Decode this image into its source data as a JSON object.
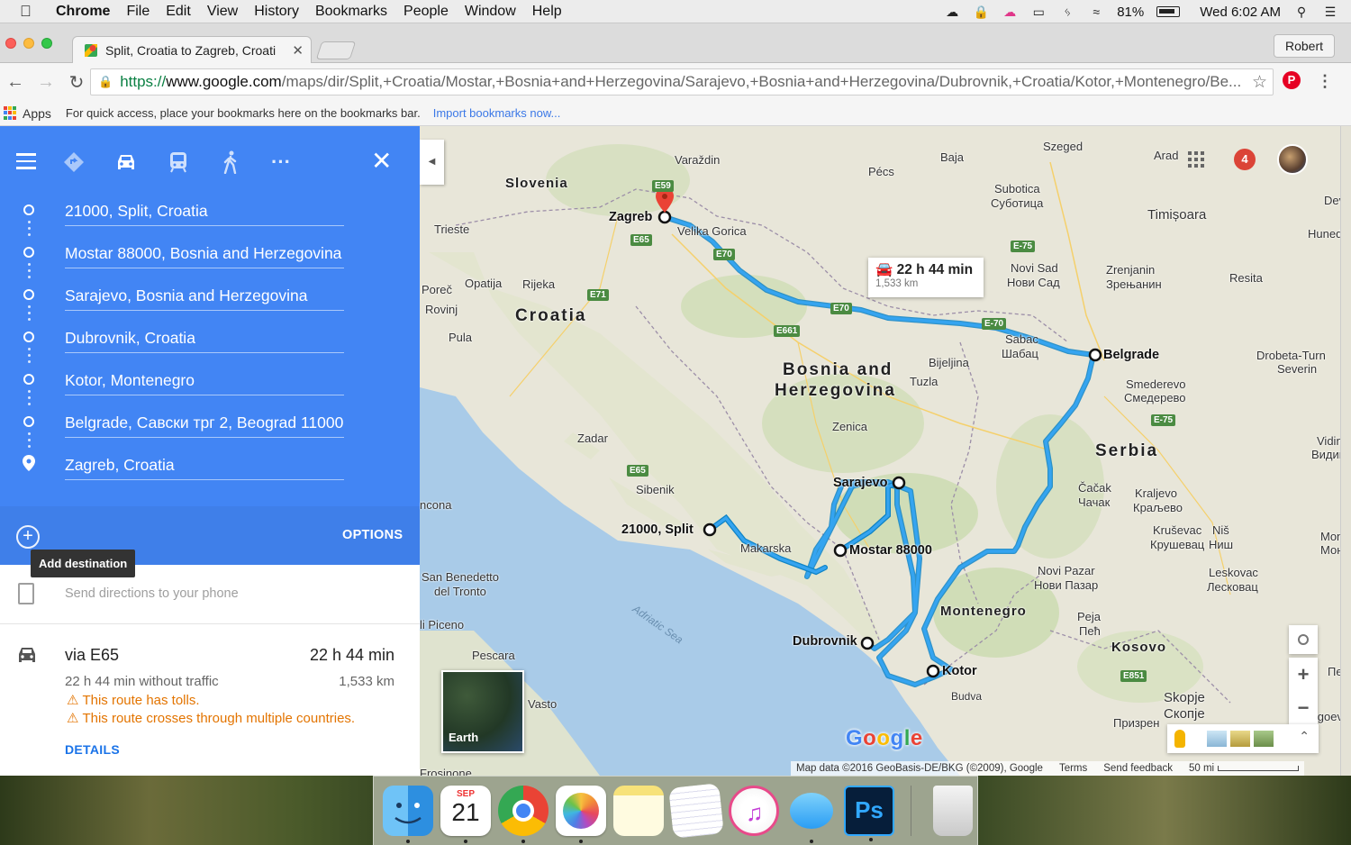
{
  "menubar": {
    "app": "Chrome",
    "items": [
      "File",
      "Edit",
      "View",
      "History",
      "Bookmarks",
      "People",
      "Window",
      "Help"
    ],
    "battery": "81%",
    "clock": "Wed 6:02 AM"
  },
  "browser": {
    "tab_title": "Split, Croatia to Zagreb, Croati",
    "profile": "Robert",
    "url_scheme": "https://",
    "url_host": "www.google.com",
    "url_path": "/maps/dir/Split,+Croatia/Mostar,+Bosnia+and+Herzegovina/Sarajevo,+Bosnia+and+Herzegovina/Dubrovnik,+Croatia/Kotor,+Montenegro/Be..."
  },
  "bookmarks": {
    "apps": "Apps",
    "hint": "For quick access, place your bookmarks here on the bookmarks bar.",
    "import_link": "Import bookmarks now..."
  },
  "directions": {
    "waypoints": [
      "21000, Split, Croatia",
      "Mostar 88000, Bosnia and Herzegovina",
      "Sarajevo, Bosnia and Herzegovina",
      "Dubrovnik, Croatia",
      "Kotor, Montenegro",
      "Belgrade, Савски трг 2, Beograd 11000",
      "Zagreb, Croatia"
    ],
    "options": "OPTIONS",
    "add_destination_tooltip": "Add destination",
    "send_to_phone": "Send directions to your phone",
    "route": {
      "via": "via E65",
      "duration": "22 h 44 min",
      "without_traffic": "22 h 44 min without traffic",
      "distance": "1,533 km",
      "warnings": [
        "This route has tolls.",
        "This route crosses through multiple countries."
      ],
      "details": "DETAILS"
    }
  },
  "map": {
    "notifications": "4",
    "infobox_duration": "22 h 44 min",
    "infobox_distance": "1,533 km",
    "countries": {
      "slovenia": "Slovenia",
      "croatia": "Croatia",
      "bosnia_1": "Bosnia and",
      "bosnia_2": "Herzegovina",
      "serbia": "Serbia",
      "montenegro": "Montenegro",
      "kosovo": "Kosovo"
    },
    "stops": {
      "zagreb": "Zagreb",
      "belgrade": "Belgrade",
      "sarajevo": "Sarajevo",
      "split": "21000, Split",
      "mostar": "Mostar 88000",
      "dubrovnik": "Dubrovnik",
      "kotor": "Kotor"
    },
    "places": {
      "varazdin": "Varaždin",
      "szeged": "Szeged",
      "baja": "Baja",
      "pecs": "Pécs",
      "subotica": "Subotica",
      "subotica_cyr": "Суботица",
      "timisoara": "Timișoara",
      "arad": "Arad",
      "deva": "Deva",
      "hunedoara": "Hunedo",
      "trieste": "Trieste",
      "velika_gorica": "Velika Gorica",
      "novi_sad": "Novi Sad",
      "novi_sad_cyr": "Нови Сад",
      "zrenjanin": "Zrenjanin",
      "zrenjanin_cyr": "Зрењанин",
      "resita": "Resita",
      "porec": "Poreč",
      "rovinj": "Rovinj",
      "opatija": "Opatija",
      "rijeka": "Rijeka",
      "pula": "Pula",
      "sabac": "Sabac",
      "sabac_cyr": "Шабац",
      "bijeljina": "Bijeljina",
      "tuzla": "Tuzla",
      "drobeta": "Drobeta-Turn",
      "severin": "Severin",
      "smederevo": "Smederevo",
      "smederevo_cyr": "Смедерево",
      "zenica": "Zenica",
      "zadar": "Zadar",
      "vidin": "Vidin",
      "vidin_cyr": "Видин",
      "sibenik": "Sibenik",
      "cacak": "Čačak",
      "cacak_cyr": "Чачак",
      "kraljevo": "Kraljevo",
      "kraljevo_cyr": "Краљево",
      "ancona": "ncona",
      "makarska": "Makarska",
      "krusevac": "Kruševac",
      "krusevac_cyr": "Крушевац",
      "nis": "Niš",
      "nis_cyr": "Ниш",
      "monta": "Monta",
      "monta2": "Монта",
      "san_benedetto": "San Benedetto",
      "del_tronto": "del Tronto",
      "novi_pazar": "Novi Pazar",
      "novi_pazar_cyr": "Нови Пазар",
      "leskovac": "Leskovac",
      "leskovac_cyr": "Лесковац",
      "piceno": "li Piceno",
      "peja": "Peja",
      "peja_cyr": "Пећ",
      "pescara": "Pescara",
      "vasto": "Vasto",
      "budva": "Budva",
      "skopje": "Skopje",
      "skopje_cyr": "Скопје",
      "prizren": "Призрен",
      "frosinone": "Frosinone",
      "pe": "Пе",
      "blagoev": "Blagoev",
      "monto": "Montenegro"
    },
    "sea": "Adriatic Sea",
    "roads": [
      "E59",
      "E65",
      "E70",
      "E71",
      "E661",
      "E70",
      "E-70",
      "E-75",
      "E-75",
      "E65",
      "E851"
    ],
    "earth": "Earth",
    "google": "Google",
    "attribution": "Map data ©2016 GeoBasis-DE/BKG (©2009), Google",
    "terms": "Terms",
    "feedback": "Send feedback",
    "scale": "50 mi"
  },
  "dock": {
    "apps": [
      "finder-icon",
      "calendar-icon",
      "chrome-icon",
      "photos-icon",
      "notes-icon",
      "textedit-icon",
      "itunes-icon",
      "messages-icon",
      "photoshop-icon",
      "trash-icon"
    ],
    "calendar_month": "SEP",
    "calendar_day": "21",
    "photoshop_label": "Ps"
  }
}
